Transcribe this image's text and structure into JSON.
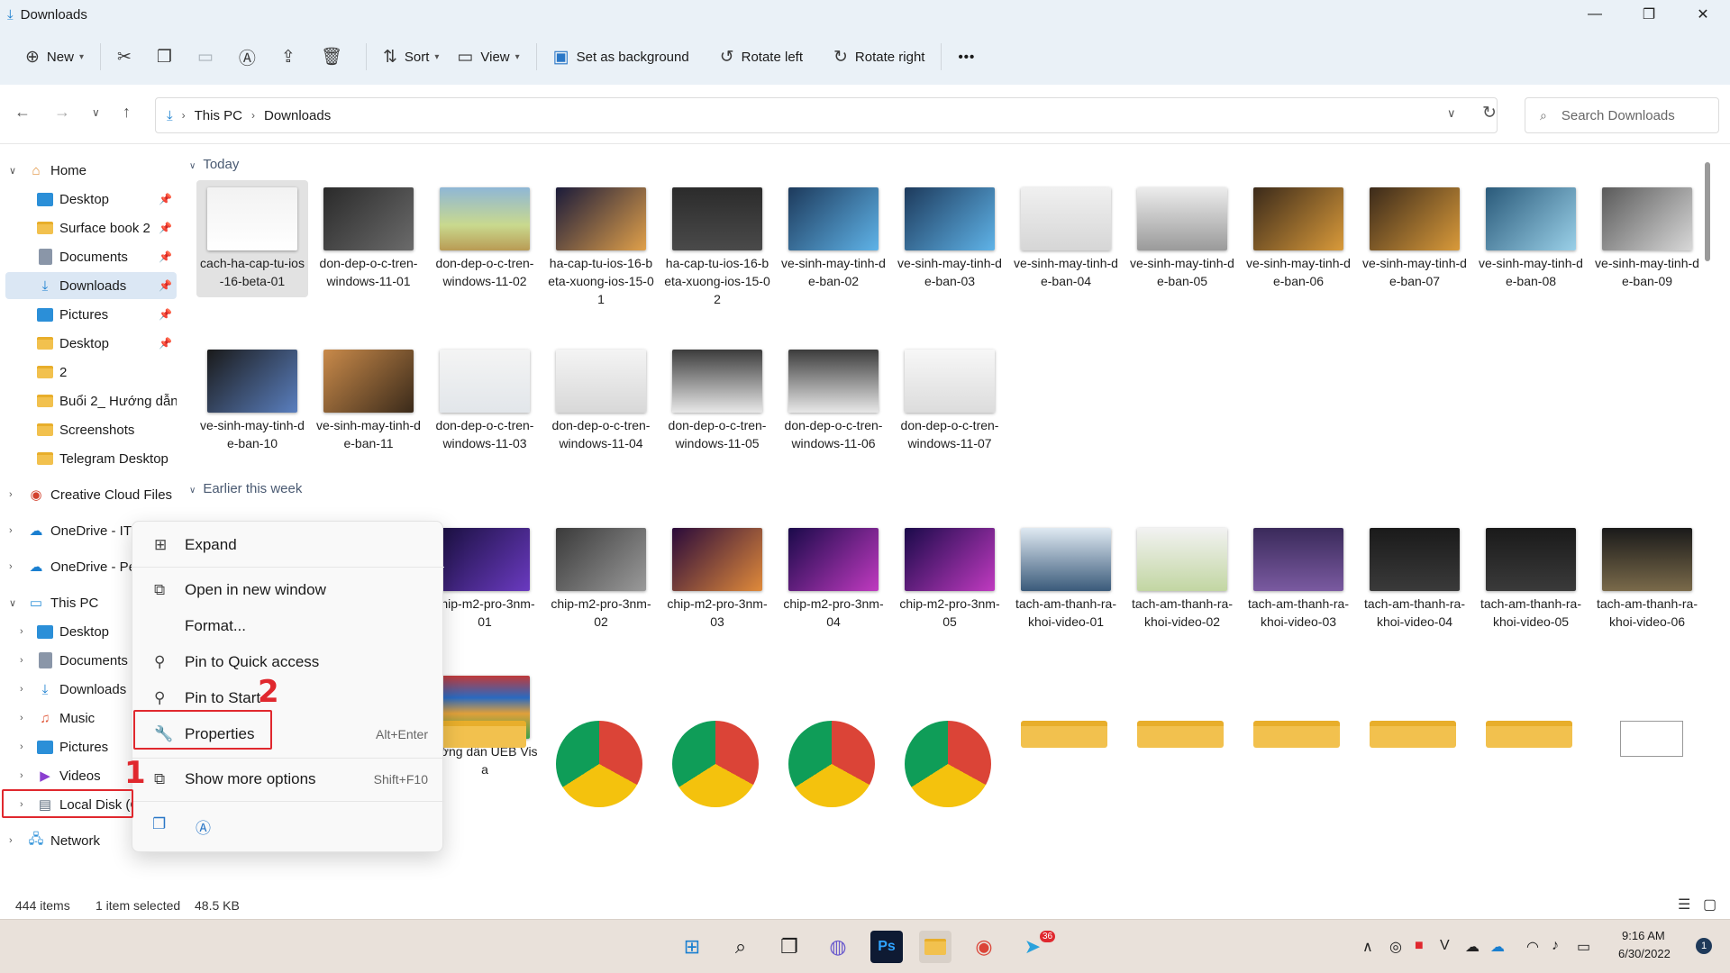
{
  "window": {
    "title": "Downloads",
    "minimize": "—",
    "maximize": "❐",
    "close": "✕"
  },
  "ribbon": {
    "new": "New",
    "sort": "Sort",
    "view": "View",
    "set_background": "Set as background",
    "rotate_left": "Rotate left",
    "rotate_right": "Rotate right",
    "more": "•••"
  },
  "address": {
    "this_pc": "This PC",
    "downloads": "Downloads",
    "search_placeholder": "Search Downloads"
  },
  "sidebar": {
    "home": "Home",
    "quick": [
      "Desktop",
      "Surface book 2",
      "Documents",
      "Downloads",
      "Pictures",
      "Desktop",
      "2",
      "Buổi 2_ Hướng dẫn",
      "Screenshots",
      "Telegram Desktop"
    ],
    "creative_cloud": "Creative Cloud Files",
    "onedrive1": "OneDrive - IT",
    "onedrive2": "OneDrive - Pe",
    "this_pc": "This PC",
    "pc_items": [
      "Desktop",
      "Documents",
      "Downloads",
      "Music",
      "Pictures",
      "Videos",
      "Local Disk (C:)"
    ],
    "network": "Network"
  },
  "groups": {
    "today": "Today",
    "earlier": "Earlier this week"
  },
  "files_today": [
    "cach-ha-cap-tu-ios-16-beta-01",
    "don-dep-o-c-tren-windows-11-01",
    "don-dep-o-c-tren-windows-11-02",
    "ha-cap-tu-ios-16-beta-xuong-ios-15-01",
    "ha-cap-tu-ios-16-beta-xuong-ios-15-02",
    "ve-sinh-may-tinh-de-ban-02",
    "ve-sinh-may-tinh-de-ban-03",
    "ve-sinh-may-tinh-de-ban-04",
    "ve-sinh-may-tinh-de-ban-05",
    "ve-sinh-may-tinh-de-ban-06",
    "ve-sinh-may-tinh-de-ban-07",
    "ve-sinh-may-tinh-de-ban-08",
    "ve-sinh-may-tinh-de-ban-09",
    "ve-sinh-may-tinh-de-ban-10",
    "ve-sinh-may-tinh-de-ban-11",
    "don-dep-o-c-tren-windows-11-03",
    "don-dep-o-c-tren-windows-11-04",
    "don-dep-o-c-tren-windows-11-05",
    "don-dep-o-c-tren-windows-11-06",
    "don-dep-o-c-tren-windows-11-07"
  ],
  "files_earlier": [
    "chip-m2-pro-3nm-01",
    "chip-m2-pro-3nm-02",
    "chip-m2-pro-3nm-03",
    "chip-m2-pro-3nm-04",
    "chip-m2-pro-3nm-05",
    "tach-am-thanh-ra-khoi-video-01",
    "tach-am-thanh-ra-khoi-video-02",
    "tach-am-thanh-ra-khoi-video-03",
    "tach-am-thanh-ra-khoi-video-04",
    "tach-am-thanh-ra-khoi-video-05",
    "tach-am-thanh-ra-khoi-video-06",
    "ướng dẫn UEB Visa"
  ],
  "context_menu": {
    "expand": "Expand",
    "open_new_window": "Open in new window",
    "format": "Format...",
    "pin_quick": "Pin to Quick access",
    "pin_start": "Pin to Start",
    "properties": "Properties",
    "properties_shortcut": "Alt+Enter",
    "show_more": "Show more options",
    "show_more_shortcut": "Shift+F10"
  },
  "annotations": {
    "step1": "1",
    "step2": "2"
  },
  "status": {
    "items": "444 items",
    "selected": "1 item selected",
    "size": "48.5 KB"
  },
  "taskbar": {
    "time": "9:16 AM",
    "date": "6/30/2022",
    "notif": "1",
    "telegram_badge": "36",
    "ps": "Ps"
  },
  "colors": {
    "accent": "#1a7fd0",
    "highlight": "#e0282e",
    "chrome": "#eaf1f7",
    "taskbar": "#e9e1da"
  },
  "icons": [
    "download-icon",
    "plus-icon",
    "cut-icon",
    "copy-icon",
    "paste-icon",
    "rename-icon",
    "share-icon",
    "trash-icon",
    "sort-icon",
    "view-icon",
    "wallpaper-icon",
    "rotate-left-icon",
    "rotate-right-icon",
    "search-icon",
    "refresh-icon"
  ]
}
